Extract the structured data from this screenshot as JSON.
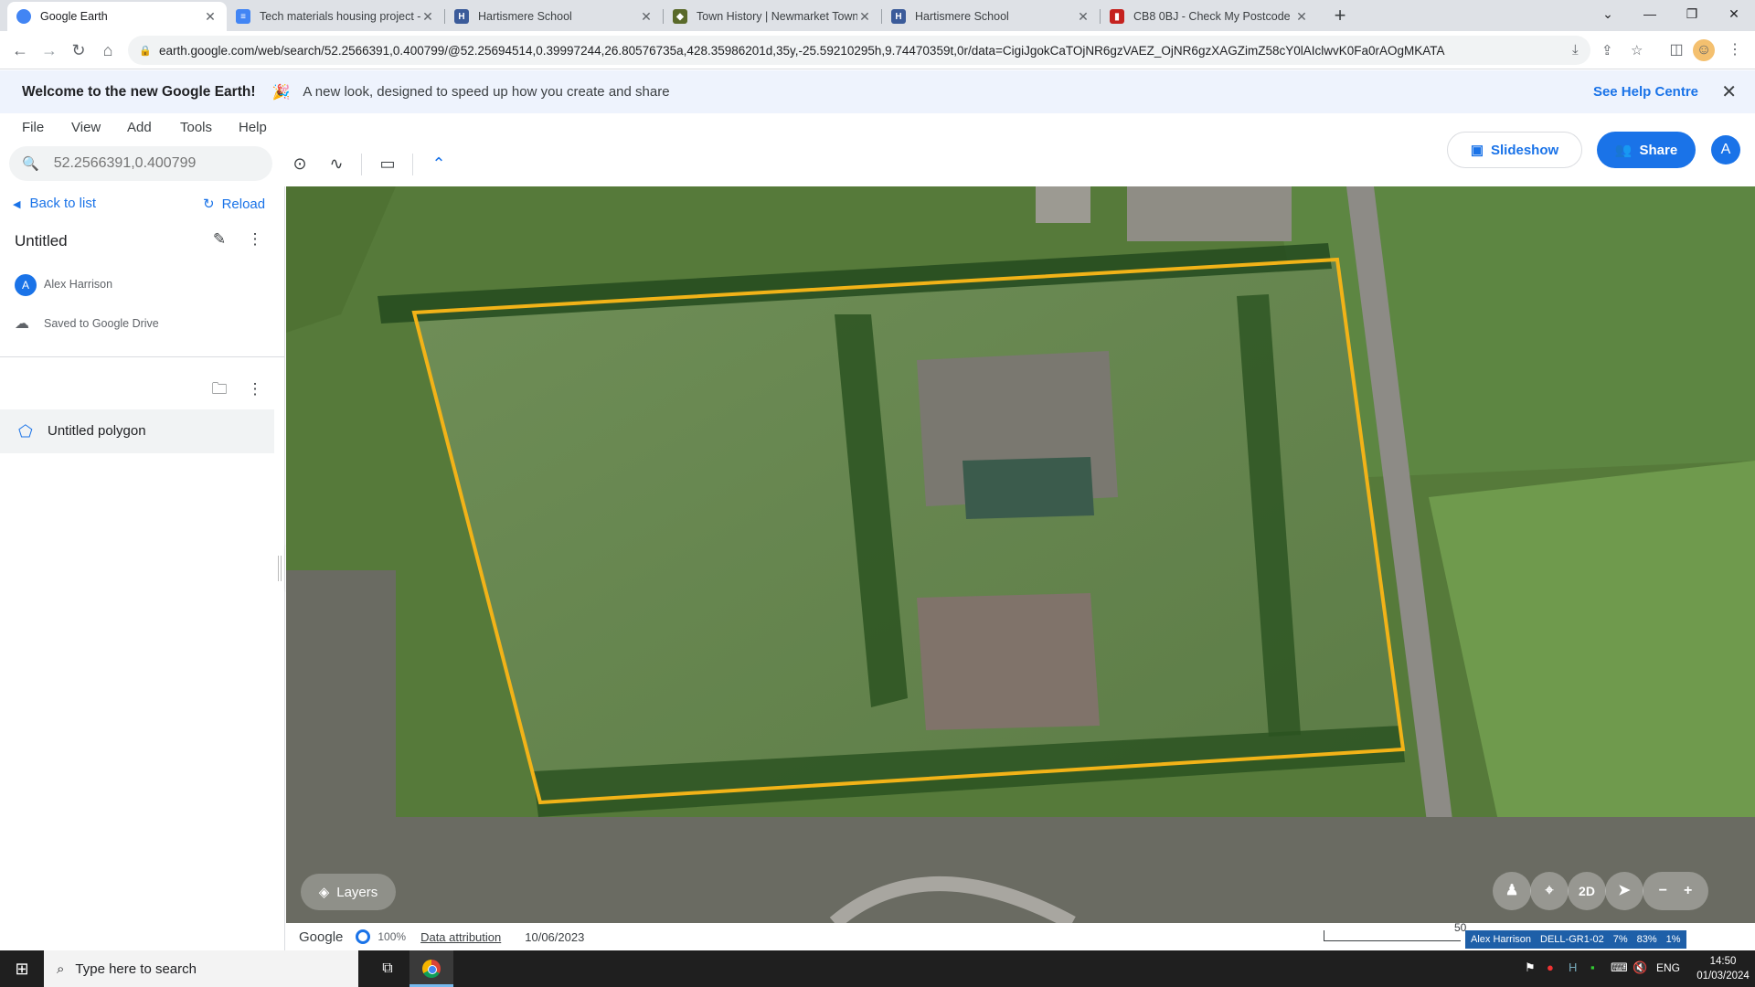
{
  "browser": {
    "tabs": [
      {
        "title": "Google Earth",
        "icon": "earth-icon"
      },
      {
        "title": "Tech materials housing project -",
        "icon": "docs-icon"
      },
      {
        "title": "Hartismere School",
        "icon": "school-icon"
      },
      {
        "title": "Town History | Newmarket Town",
        "icon": "crest-icon"
      },
      {
        "title": "Hartismere School",
        "icon": "school-icon"
      },
      {
        "title": "CB8 0BJ - Check My Postcode",
        "icon": "postcode-icon"
      }
    ],
    "url": "earth.google.com/web/search/52.2566391,0.400799/@52.25694514,0.39997244,26.80576735a,428.35986201d,35y,-25.59210295h,9.74470359t,0r/data=CigiJgokCaTOjNR6gzVAEZ_OjNR6gzXAGZimZ58cY0lAIclwvK0Fa0rAOgMKATA"
  },
  "banner": {
    "title": "Welcome to the new Google Earth!",
    "emoji": "🎉",
    "text": "A new look, designed to speed up how you create and share",
    "help": "See Help Centre"
  },
  "menu": {
    "items": [
      "File",
      "View",
      "Add",
      "Tools",
      "Help"
    ]
  },
  "search": {
    "placeholder": "52.2566391,0.400799"
  },
  "actions": {
    "slideshow": "Slideshow",
    "share": "Share",
    "avatar_initial": "A"
  },
  "panel": {
    "back": "Back to list",
    "reload": "Reload",
    "title": "Untitled",
    "owner_initial": "A",
    "owner": "Alex Harrison",
    "saved": "Saved to Google Drive",
    "feature": "Untitled polygon"
  },
  "map": {
    "layers": "Layers",
    "view_mode": "2D",
    "polygon_color": "#f2b318"
  },
  "footer": {
    "brand": "Google",
    "progress": "100%",
    "attribution": "Data attribution",
    "date": "10/06/2023",
    "scale": "50",
    "bginfo": [
      "Alex Harrison",
      "DELL-GR1-02",
      "7%",
      "83%",
      "1%"
    ]
  },
  "taskbar": {
    "search": "Type here to search",
    "lang": "ENG",
    "time": "14:50",
    "date": "01/03/2024"
  }
}
